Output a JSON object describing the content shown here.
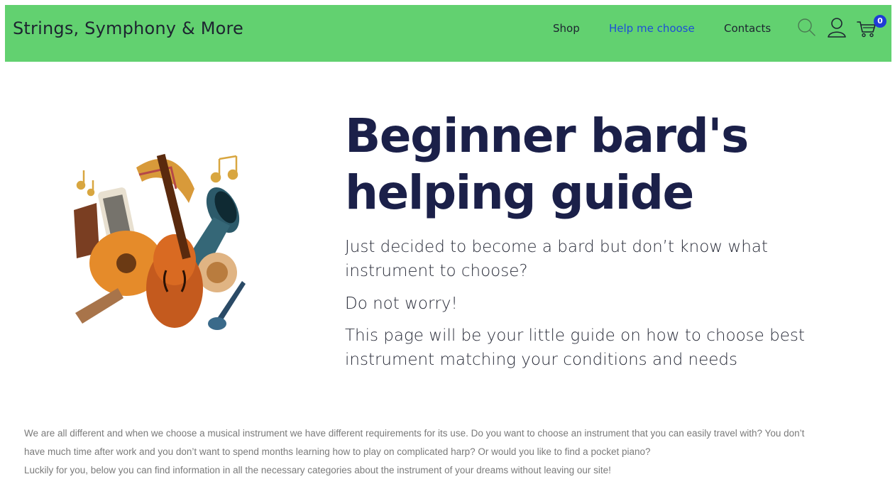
{
  "header": {
    "brand": "Strings, Symphony & More",
    "nav": [
      {
        "label": "Shop"
      },
      {
        "label": "Help me choose"
      },
      {
        "label": "Contacts"
      }
    ],
    "cart_count": "0",
    "icons": [
      "search-icon",
      "user-icon",
      "cart-icon"
    ],
    "colors": {
      "bar": "#62d170",
      "active_link": "#1d4ed8",
      "badge": "#1f3bd6"
    }
  },
  "hero": {
    "title_line1": "Beginner bard's",
    "title_line2": "helping guide",
    "text1_line1": "Just decided to become a bard but don’t know what",
    "text1_line2": "instrument to choose?",
    "text2": "Do not worry!",
    "text3_line1": "This page will be your little guide on how to choose best",
    "text3_line2": "instrument matching your conditions and needs",
    "image": "musical-instruments-illustration"
  },
  "intro": {
    "line1": "We are all different and when we choose a musical instrument we have different requirements for its use. Do you want to choose an instrument that you can easily travel with? You don’t",
    "line2": "have much time after work and you don’t want to spend months learning how to play on complicated harp? Or would you like to find a pocket piano?",
    "line3": "Luckily for you, below you can find information in all the necessary categories about the instrument of your dreams without leaving our site!"
  }
}
